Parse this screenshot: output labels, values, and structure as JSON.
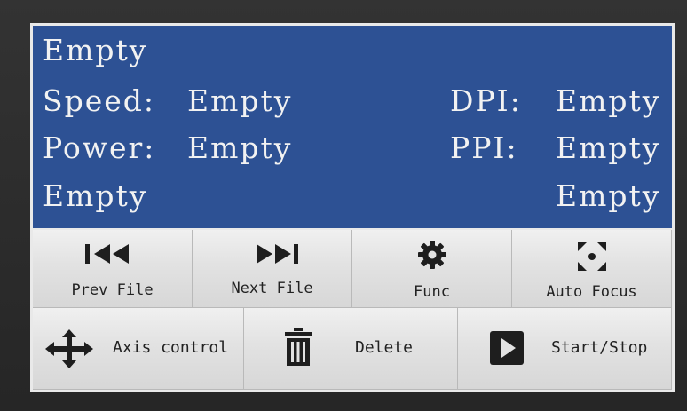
{
  "display": {
    "file_name": "Empty",
    "speed_label": "Speed:",
    "speed_value": "Empty",
    "power_label": "Power:",
    "power_value": "Empty",
    "dpi_label": "DPI:",
    "dpi_value": "Empty",
    "ppi_label": "PPI:",
    "ppi_value": "Empty",
    "status_left": "Empty",
    "status_right": "Empty"
  },
  "buttons": {
    "prev_file": "Prev File",
    "next_file": "Next File",
    "func": "Func",
    "auto_focus": "Auto Focus",
    "axis_control": "Axis control",
    "delete": "Delete",
    "start_stop": "Start/Stop"
  },
  "colors": {
    "lcd_background": "#2d5194",
    "button_face": "#e2e2e2",
    "icon": "#1e1e1e"
  },
  "icons": [
    "skip-previous-icon",
    "skip-next-icon",
    "gear-icon",
    "focus-target-icon",
    "move-arrows-icon",
    "trash-icon",
    "play-icon"
  ]
}
